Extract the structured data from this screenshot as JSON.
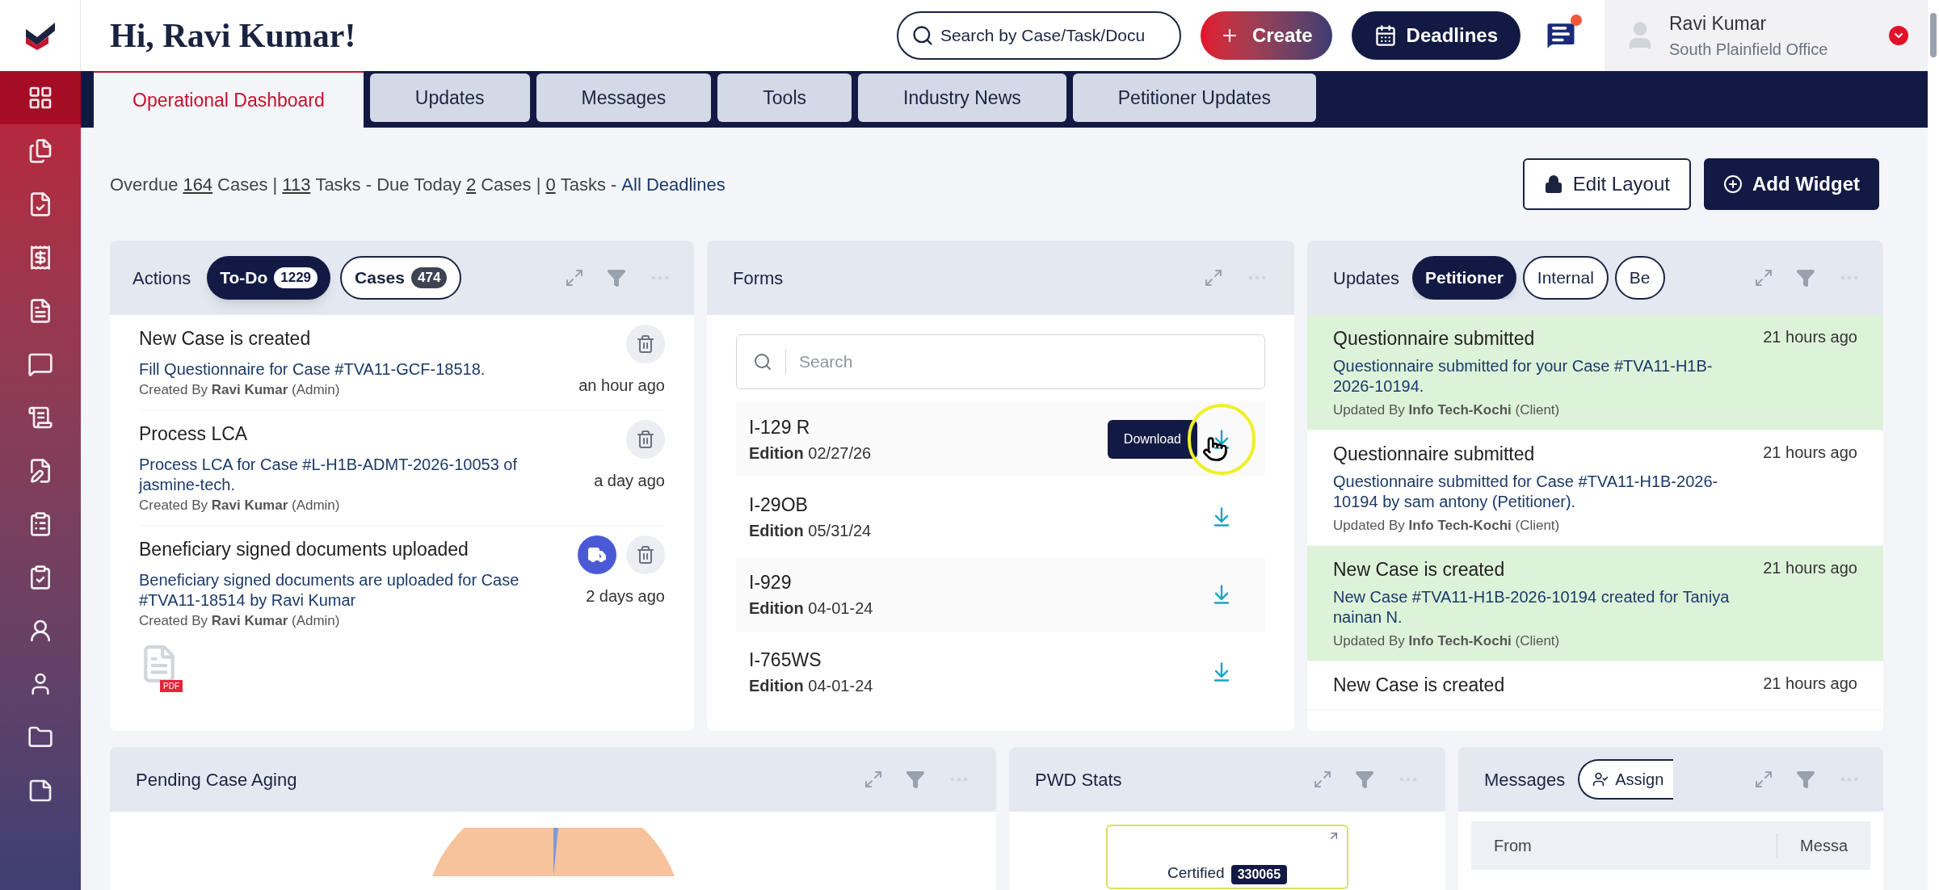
{
  "header": {
    "greeting": "Hi, Ravi Kumar!",
    "search": {
      "placeholder": "Search by Case/Task/Docu"
    },
    "create_label": "Create",
    "deadlines_label": "Deadlines",
    "has_unread": true,
    "user": {
      "name": "Ravi Kumar",
      "office": "South Plainfield Office"
    }
  },
  "sidebar": {
    "items": [
      {
        "selected": true
      },
      {
        "selected": false
      },
      {
        "selected": false
      },
      {
        "selected": false
      },
      {
        "selected": false
      },
      {
        "selected": false
      },
      {
        "selected": false
      },
      {
        "selected": false
      },
      {
        "selected": false
      },
      {
        "selected": false
      },
      {
        "selected": false
      },
      {
        "selected": false
      },
      {
        "selected": false
      },
      {
        "selected": false
      }
    ]
  },
  "tabs": [
    {
      "label": "Operational Dashboard",
      "selected": true
    },
    {
      "label": "Updates",
      "selected": false
    },
    {
      "label": "Messages",
      "selected": false
    },
    {
      "label": "Tools",
      "selected": false
    },
    {
      "label": "Industry News",
      "selected": false
    },
    {
      "label": "Petitioner Updates",
      "selected": false
    }
  ],
  "summary": [
    {
      "kind": "text",
      "text": "Overdue"
    },
    {
      "kind": "link",
      "text": "164"
    },
    {
      "kind": "text",
      "text": "Cases |"
    },
    {
      "kind": "link",
      "text": "113"
    },
    {
      "kind": "text",
      "text": "Tasks - Due Today"
    },
    {
      "kind": "link",
      "text": "2"
    },
    {
      "kind": "text",
      "text": "Cases |"
    },
    {
      "kind": "link",
      "text": "0"
    },
    {
      "kind": "text",
      "text": "Tasks -"
    },
    {
      "kind": "all",
      "text": "All Deadlines"
    }
  ],
  "toolbar": {
    "edit_layout": "Edit Layout",
    "add_widget": "Add Widget"
  },
  "actions": {
    "title": "Actions",
    "filters": [
      {
        "label": "To-Do",
        "count": "1229",
        "selected": true
      },
      {
        "label": "Cases",
        "count": "474",
        "selected": false
      }
    ],
    "items": [
      {
        "title": "New Case is created",
        "body": "Fill Questionnaire for Case #TVA11-GCF-18518.",
        "byline": "Created By **Ravi Kumar** (Admin)",
        "time": "an hour ago",
        "has_truck": false
      },
      {
        "title": "Process LCA",
        "body": "Process LCA for Case #L-H1B-ADMT-2026-10053 of jasmine-tech.",
        "byline": "Created By **Ravi Kumar** (Admin)",
        "time": "a day ago",
        "has_truck": false
      },
      {
        "title": "Beneficiary signed documents uploaded",
        "body": "Beneficiary signed documents are uploaded for Case #TVA11-18514 by Ravi Kumar",
        "byline": "Created By **Ravi Kumar** (Admin)",
        "time": "2 days ago",
        "has_truck": true,
        "attachment": "PDF"
      }
    ]
  },
  "forms": {
    "title": "Forms",
    "search": {
      "placeholder": "Search"
    },
    "items": [
      {
        "name": "I-129 R",
        "edition_label": "Edition",
        "edition": "02/27/26",
        "tooltip": "Download"
      },
      {
        "name": "I-29OB",
        "edition_label": "Edition",
        "edition": "05/31/24"
      },
      {
        "name": "I-929",
        "edition_label": "Edition",
        "edition": "04-01-24"
      },
      {
        "name": "I-765WS",
        "edition_label": "Edition",
        "edition": "04-01-24"
      }
    ]
  },
  "updates": {
    "title": "Updates",
    "filters": [
      {
        "label": "Petitioner",
        "selected": true
      },
      {
        "label": "Internal",
        "selected": false
      },
      {
        "label": "Be",
        "selected": false
      }
    ],
    "items": [
      {
        "title": "Questionnaire submitted",
        "time": "21 hours ago",
        "body": "Questionnaire submitted for your Case #TVA11-H1B-2026-10194.",
        "byline": "Updated By **Info Tech-Kochi** (Client)",
        "highlighted": true
      },
      {
        "title": "Questionnaire submitted",
        "time": "21 hours ago",
        "body": "Questionnaire submitted for Case #TVA11-H1B-2026-10194 by sam antony (Petitioner).",
        "byline": "Updated By **Info Tech-Kochi** (Client)",
        "highlighted": false
      },
      {
        "title": "New Case is created",
        "time": "21 hours ago",
        "body": "New Case #TVA11-H1B-2026-10194 created for Taniya nainan N.",
        "byline": "Updated By **Info Tech-Kochi** (Client)",
        "highlighted": true
      },
      {
        "title": "New Case is created",
        "time": "21 hours ago",
        "highlighted": false
      }
    ]
  },
  "pending": {
    "title": "Pending Case Aging"
  },
  "pwd": {
    "title": "PWD Stats",
    "card": {
      "label": "Certified",
      "count": "330065"
    }
  },
  "messages": {
    "title": "Messages",
    "filter": "Assign",
    "columns": [
      "From",
      "Messa"
    ]
  }
}
